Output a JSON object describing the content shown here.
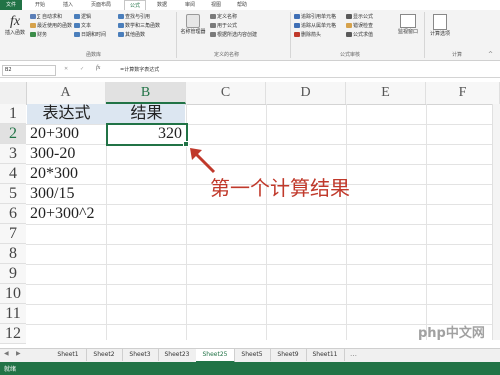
{
  "ribbon": {
    "tabs": [
      "文件",
      "开始",
      "插入",
      "页面布局",
      "公式",
      "数据",
      "审阅",
      "视图",
      "帮助"
    ],
    "active_tab": "公式",
    "insert_function": {
      "icon": "fx",
      "label": "插入函数"
    },
    "function_library": {
      "items": [
        "∑ 自动求和",
        "最近使用的函数",
        "财务",
        "逻辑",
        "文本",
        "日期和时间",
        "查找与引用",
        "数学和三角函数",
        "其他函数"
      ],
      "group_label": "函数库"
    },
    "defined_names": {
      "manager_label": "名称管理器",
      "items": [
        "定义名称",
        "用于公式",
        "根据所选内容创建"
      ],
      "group_label": "定义的名称"
    },
    "formula_auditing": {
      "items": [
        "追踪引用单元格",
        "追踪从属单元格",
        "删除箭头",
        "显示公式",
        "错误检查",
        "公式求值"
      ],
      "watch_label": "监视窗口",
      "group_label": "公式审核"
    },
    "calculation": {
      "label": "计算选项",
      "group_label": "计算"
    }
  },
  "formula_bar": {
    "name_box": "B2",
    "fx": "fx",
    "formula": "=计算数字表达式"
  },
  "grid": {
    "columns": [
      "A",
      "B",
      "C",
      "D",
      "E",
      "F"
    ],
    "selected_column": "B",
    "rows": [
      "1",
      "2",
      "3",
      "4",
      "5",
      "6",
      "7",
      "8",
      "9",
      "10",
      "11",
      "12"
    ],
    "selected_row": "2",
    "header_a": "表达式",
    "header_b": "结果",
    "expressions": [
      "20+300",
      "300-20",
      "20*300",
      "300/15",
      "20+300^2"
    ],
    "b2_value": "320"
  },
  "annotation": {
    "text": "第一个计算结果",
    "color": "#c0392b"
  },
  "sheets": {
    "tabs": [
      "Sheet1",
      "Sheet2",
      "Sheet3",
      "Sheet23",
      "Sheet25",
      "Sheet5",
      "Sheet9",
      "Sheet11"
    ],
    "active": "Sheet25"
  },
  "status_bar": {
    "text": "就绪"
  },
  "watermark": "php中文网",
  "colors": {
    "accent": "#217346",
    "annotation": "#c0392b"
  }
}
